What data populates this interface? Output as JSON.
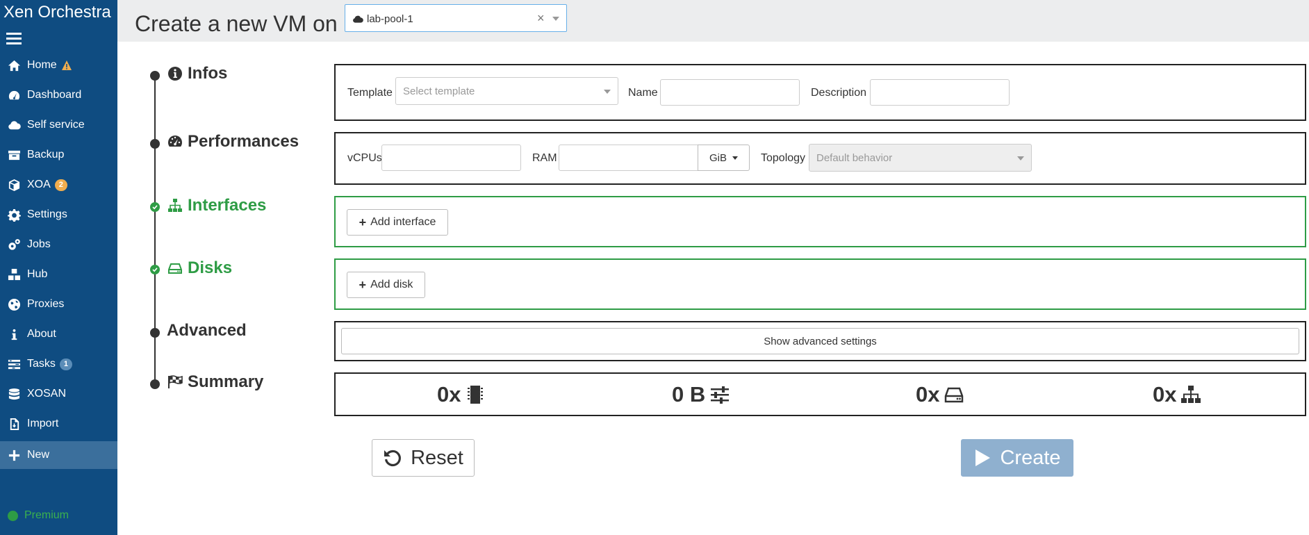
{
  "app": {
    "title": "Xen Orchestra"
  },
  "sidebar": {
    "items": [
      {
        "label": "Home",
        "icon": "home-icon",
        "badge": "",
        "warning": true
      },
      {
        "label": "Dashboard",
        "icon": "dashboard-icon",
        "badge": ""
      },
      {
        "label": "Self service",
        "icon": "cloud-icon",
        "badge": ""
      },
      {
        "label": "Backup",
        "icon": "archive-icon",
        "badge": ""
      },
      {
        "label": "XOA",
        "icon": "cube-icon",
        "badge": "2"
      },
      {
        "label": "Settings",
        "icon": "gear-icon",
        "badge": ""
      },
      {
        "label": "Jobs",
        "icon": "gears-icon",
        "badge": ""
      },
      {
        "label": "Hub",
        "icon": "cubes-icon",
        "badge": ""
      },
      {
        "label": "Proxies",
        "icon": "globe-icon",
        "badge": ""
      },
      {
        "label": "About",
        "icon": "info-icon",
        "badge": ""
      },
      {
        "label": "Tasks",
        "icon": "tasks-icon",
        "badge": "1"
      },
      {
        "label": "XOSAN",
        "icon": "database-icon",
        "badge": ""
      },
      {
        "label": "Import",
        "icon": "file-import-icon",
        "badge": ""
      },
      {
        "label": "New",
        "icon": "plus-icon",
        "badge": "",
        "active": true
      }
    ],
    "premium_label": "Premium"
  },
  "header": {
    "title": "Create a new VM on",
    "pool": "lab-pool-1"
  },
  "steps": {
    "infos": "Infos",
    "performances": "Performances",
    "interfaces": "Interfaces",
    "disks": "Disks",
    "advanced": "Advanced",
    "summary": "Summary"
  },
  "infos": {
    "template_label": "Template",
    "template_placeholder": "Select template",
    "name_label": "Name",
    "name_value": "",
    "description_label": "Description",
    "description_value": ""
  },
  "performances": {
    "vcpus_label": "vCPUs",
    "vcpus_value": "",
    "ram_label": "RAM",
    "ram_value": "",
    "ram_unit": "GiB",
    "topology_label": "Topology",
    "topology_placeholder": "Default behavior"
  },
  "interfaces": {
    "add_label": "Add interface"
  },
  "disks": {
    "add_label": "Add disk"
  },
  "advanced": {
    "show_label": "Show advanced settings"
  },
  "summary": {
    "cpus": "0x",
    "ram": "0 B",
    "disks": "0x",
    "interfaces": "0x"
  },
  "actions": {
    "reset_label": "Reset",
    "create_label": "Create"
  },
  "colors": {
    "sidebar": "#0f4c81",
    "active_nav": "#3b6f9c",
    "success": "#2e9c45",
    "create_button": "#8fb0cf"
  }
}
